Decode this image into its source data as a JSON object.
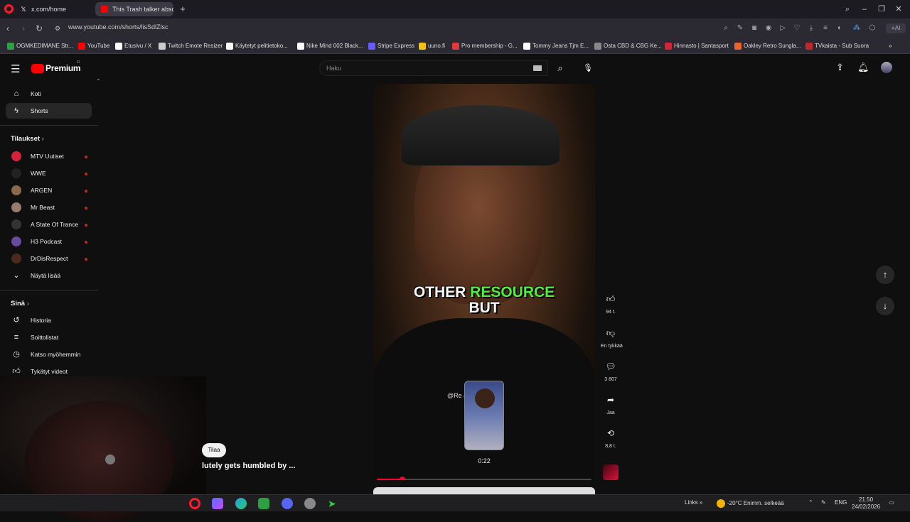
{
  "browser": {
    "tabs": [
      {
        "label": "x.com/home",
        "icon": "x-logo-icon",
        "active": false
      },
      {
        "label": "This Trash talker absolu",
        "icon": "youtube-icon",
        "active": true
      }
    ],
    "url": "www.youtube.com/shorts/lisSdlZlsc",
    "bookmarks": [
      {
        "label": "OGMKEDIMANE Str...",
        "color": "#2ea043"
      },
      {
        "label": "YouTube",
        "color": "#ff0000"
      },
      {
        "label": "Etusivu / X",
        "color": "#ffffff"
      },
      {
        "label": "Twitch Emote Resizer",
        "color": "#cccccc"
      },
      {
        "label": "Käytetyt pelitietoko...",
        "color": "#ffffff"
      },
      {
        "label": "Nike Mind 002 Black...",
        "color": "#ffffff"
      },
      {
        "label": "Stripe Express",
        "color": "#635bff"
      },
      {
        "label": "uuno.fi",
        "color": "#f4c20d"
      },
      {
        "label": "Pro membership - G...",
        "color": "#e03a3a"
      },
      {
        "label": "Tommy Jeans Tjm E...",
        "color": "#ffffff"
      },
      {
        "label": "Osta CBD & CBG Ke...",
        "color": "#888888"
      },
      {
        "label": "Hinnasto | Santasport",
        "color": "#d6223a"
      },
      {
        "label": "Oakley Retro Sungla...",
        "color": "#e8642c"
      },
      {
        "label": "TVkaista - Sub Suora",
        "color": "#c0262c"
      }
    ]
  },
  "youtube": {
    "logo": "Premium",
    "logo_sup": "FI",
    "search_placeholder": "Haku",
    "nav": [
      {
        "label": "Koti",
        "icon": "home-icon"
      },
      {
        "label": "Shorts",
        "icon": "shorts-icon",
        "active": true
      }
    ],
    "subscriptions_title": "Tilaukset",
    "subscriptions": [
      {
        "label": "MTV Uutiset",
        "color": "#d6223a"
      },
      {
        "label": "WWE",
        "color": "#222222"
      },
      {
        "label": "ARGEN",
        "color": "#8a6a4a"
      },
      {
        "label": "Mr Beast",
        "color": "#9a7a6a"
      },
      {
        "label": "A State Of Trance",
        "color": "#333333"
      },
      {
        "label": "H3 Podcast",
        "color": "#6a4aa0"
      },
      {
        "label": "DrDisRespect",
        "color": "#4a2a1a"
      }
    ],
    "show_more": "Näytä lisää",
    "you_title": "Sinä",
    "you_items": [
      {
        "label": "Historia",
        "icon": "history-icon"
      },
      {
        "label": "Soittolistat",
        "icon": "playlists-icon"
      },
      {
        "label": "Katso myöhemmin",
        "icon": "watch-later-icon"
      },
      {
        "label": "Tykätyt videot",
        "icon": "liked-videos-icon"
      }
    ]
  },
  "short": {
    "caption_word1": "OTHER",
    "caption_word2": "RESOURCE",
    "caption_word3": "BUT",
    "watermark": "@Re                  ality",
    "thumb_time": "0:22",
    "progress_fraction": 0.12,
    "scrub_fraction": 0.51,
    "actions": [
      {
        "name": "like",
        "icon": "thumbs-up-icon",
        "label": "94 t."
      },
      {
        "name": "dislike",
        "icon": "thumbs-down-icon",
        "label": "En tykkää"
      },
      {
        "name": "comments",
        "icon": "comment-icon",
        "label": "3 807"
      },
      {
        "name": "share",
        "icon": "share-icon",
        "label": "Jaa"
      },
      {
        "name": "remix",
        "icon": "remix-icon",
        "label": "8,8 t."
      }
    ]
  },
  "overlay": {
    "subscribe_label": "Tilaa",
    "subtitle": "lutely gets humbled by ..."
  },
  "taskbar": {
    "links_label": "Links",
    "weather": "-20°C  Enimm. selkeää",
    "lang": "ENG",
    "time": "21.50",
    "date": "24/02/2026"
  }
}
